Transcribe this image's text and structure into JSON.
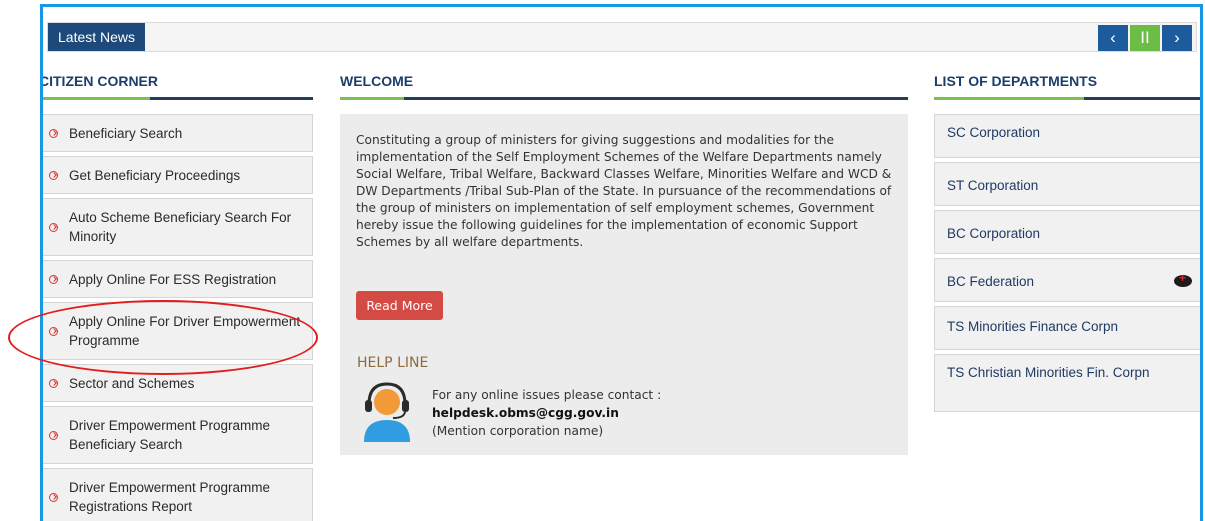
{
  "news": {
    "label": "Latest News",
    "prev_icon": "‹",
    "pause_icon": "II",
    "next_icon": "›"
  },
  "citizen_corner": {
    "title": "CITIZEN CORNER",
    "items": [
      {
        "label": "Beneficiary Search"
      },
      {
        "label": "Get Beneficiary Proceedings"
      },
      {
        "label": "Auto Scheme Beneficiary Search For Minority"
      },
      {
        "label": "Apply Online For ESS Registration"
      },
      {
        "label": "Apply Online For Driver Empowerment Programme"
      },
      {
        "label": "Sector and Schemes"
      },
      {
        "label": "Driver Empowerment Programme Beneficiary Search"
      },
      {
        "label": "Driver Empowerment Programme Registrations Report"
      }
    ]
  },
  "welcome": {
    "title": "WELCOME",
    "body": "Constituting a group of ministers for giving suggestions and modalities for the implementation of the Self Employment Schemes of the Welfare Departments namely Social Welfare, Tribal Welfare, Backward Classes Welfare, Minorities Welfare and WCD & DW Departments /Tribal Sub-Plan of the State. In pursuance of the recommendations of the group of ministers on implementation of self employment schemes, Government hereby issue the following guidelines for the implementation of economic Support Schemes by all welfare departments.",
    "read_more": "Read More",
    "helpline": {
      "title": "HELP LINE",
      "line1": "For any online issues please contact :",
      "email": "helpdesk.obms@cgg.gov.in",
      "line3": "(Mention corporation name)"
    }
  },
  "departments": {
    "title": "LIST OF DEPARTMENTS",
    "items": [
      {
        "label": "SC Corporation"
      },
      {
        "label": "ST Corporation"
      },
      {
        "label": "BC Corporation"
      },
      {
        "label": "BC Federation"
      },
      {
        "label": "TS Minorities Finance Corpn"
      },
      {
        "label": "TS Christian Minorities Fin. Corpn"
      }
    ]
  },
  "colors": {
    "accent_blue": "#1d4a7a",
    "accent_green": "#7ac24d",
    "highlight_red": "#e21d1d"
  }
}
